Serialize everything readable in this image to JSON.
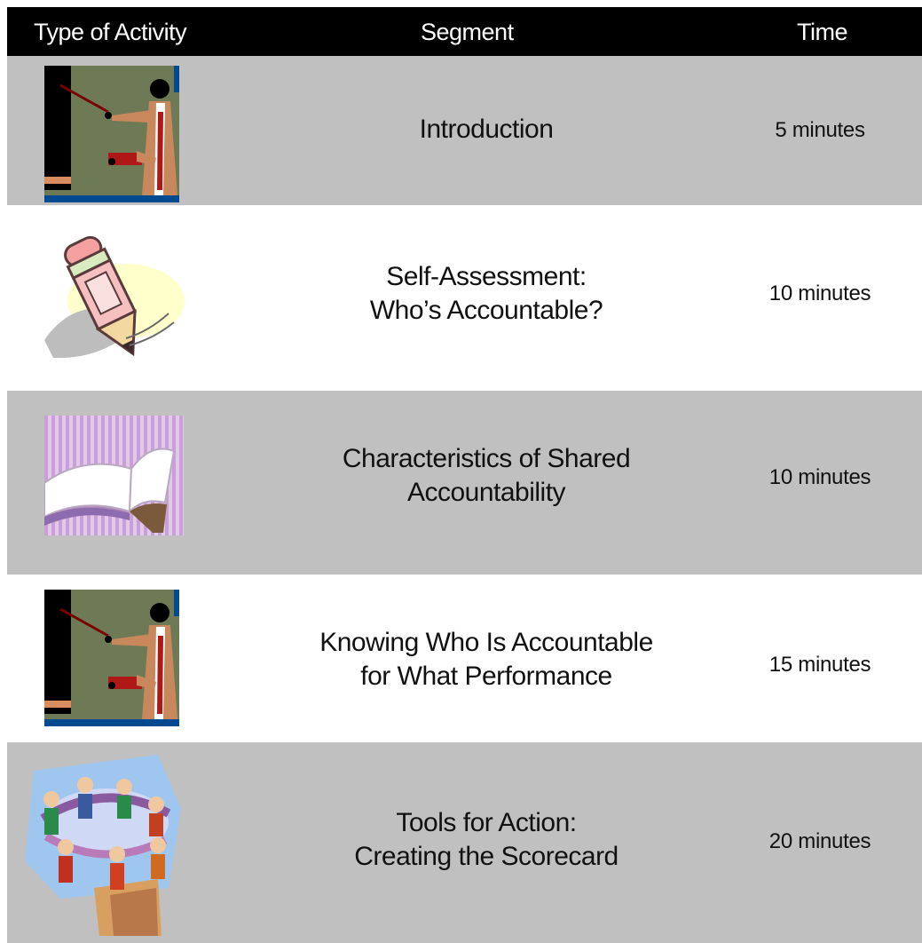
{
  "header": {
    "type_label": "Type of Activity",
    "segment_label": "Segment",
    "time_label": "Time"
  },
  "rows": [
    {
      "icon": "presenter-icon",
      "segment": [
        "Introduction"
      ],
      "time": "5 minutes"
    },
    {
      "icon": "pencil-icon",
      "segment": [
        "Self-Assessment:",
        "Who’s Accountable?"
      ],
      "time": "10 minutes"
    },
    {
      "icon": "open-book-icon",
      "segment": [
        "Characteristics of Shared",
        "Accountability"
      ],
      "time": "10 minutes"
    },
    {
      "icon": "presenter-icon",
      "segment": [
        "Knowing Who Is Accountable",
        "for What Performance"
      ],
      "time": "15 minutes"
    },
    {
      "icon": "team-group-icon",
      "segment": [
        "Tools for Action:",
        "Creating the Scorecard"
      ],
      "time": "20 minutes"
    }
  ],
  "colors": {
    "header_bg": "#000000",
    "shaded_row": "#c0c0c0",
    "text": "#111111"
  }
}
